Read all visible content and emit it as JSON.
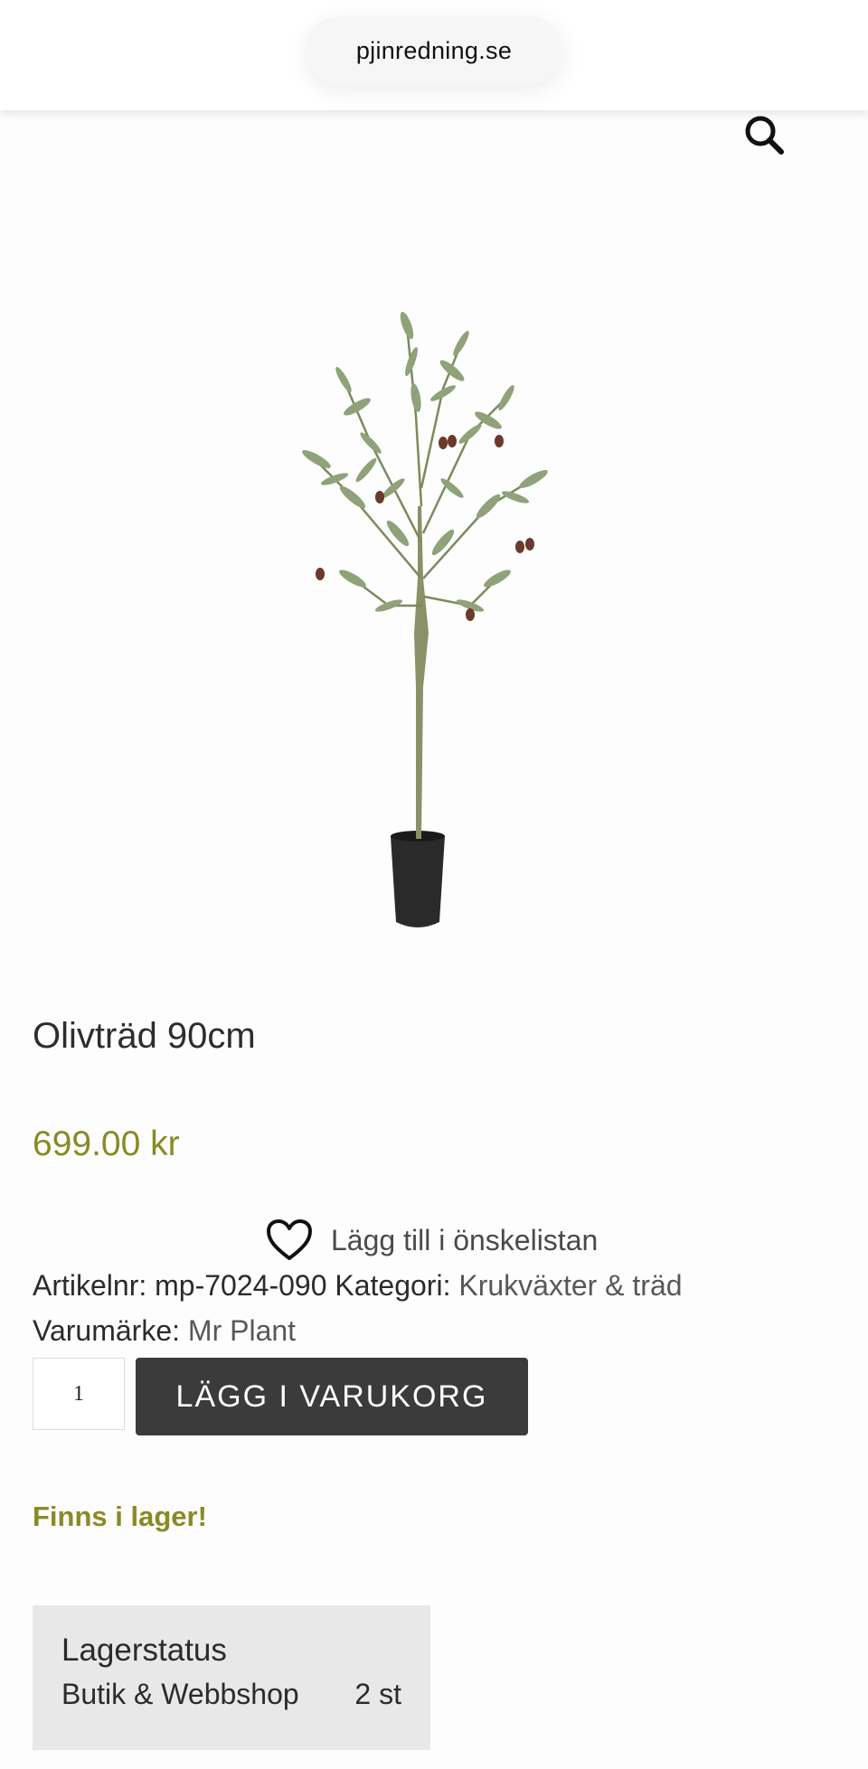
{
  "browser": {
    "url": "pjinredning.se"
  },
  "header": {
    "search_icon": "search-icon"
  },
  "product": {
    "image_icon": "olive-tree-in-pot",
    "title": "Olivträd 90cm",
    "price": "699.00 kr",
    "wishlist_label": "Lägg till i önskelistan",
    "article_label": "Artikelnr:",
    "article_number": "mp-7024-090",
    "category_label": "Kategori:",
    "category_value": "Krukväxter & träd",
    "brand_label": "Varumärke:",
    "brand_value": "Mr Plant",
    "quantity": "1",
    "add_to_cart_label": "LÄGG I VARUKORG",
    "stock_message": "Finns i lager!"
  },
  "stock_status": {
    "title": "Lagerstatus",
    "rows": [
      {
        "location": "Butik & Webbshop",
        "amount": "2 st"
      }
    ]
  },
  "colors": {
    "accent": "#8a8a24",
    "button": "#3b3b3b",
    "stock_box": "#e8e8e8"
  }
}
